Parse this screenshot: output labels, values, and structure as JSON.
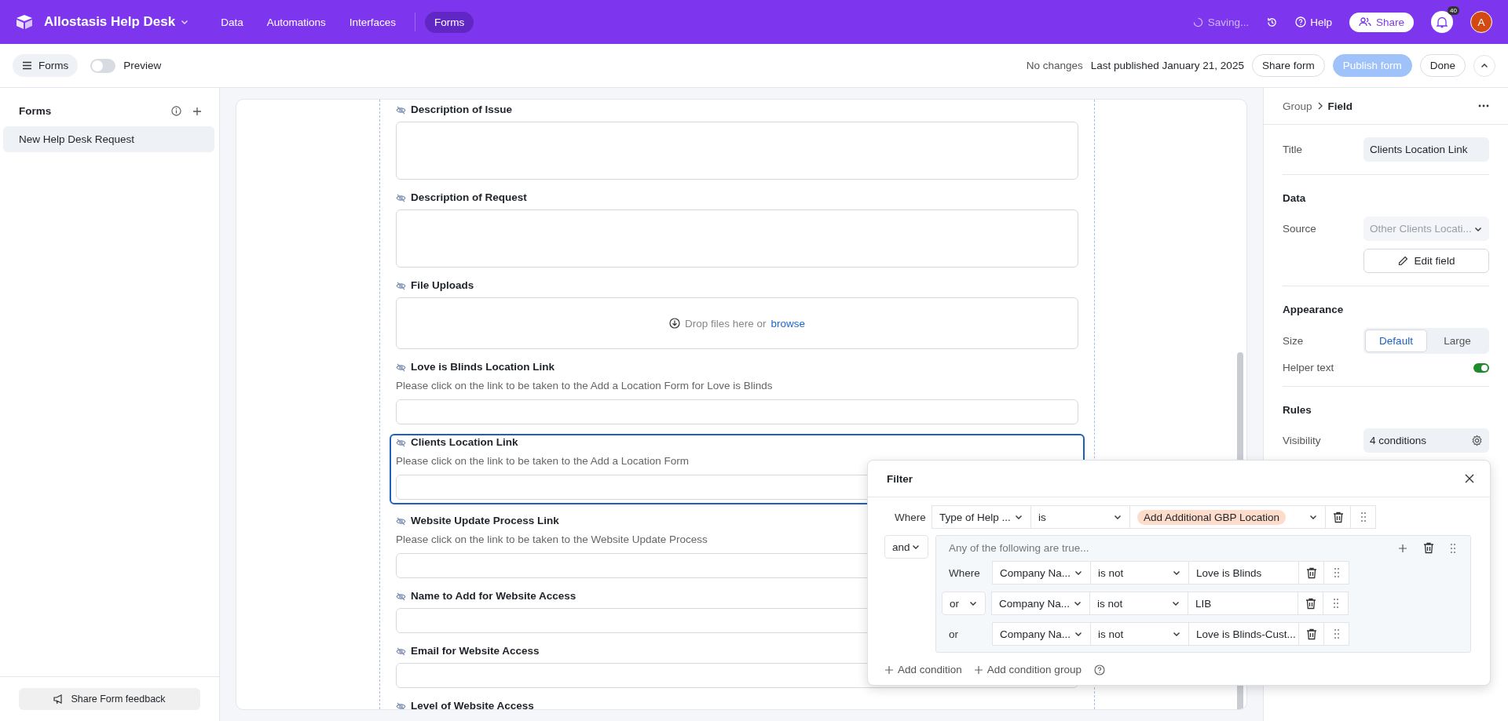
{
  "topbar": {
    "app_name": "Allostasis Help Desk",
    "nav": [
      {
        "label": "Data",
        "selected": false
      },
      {
        "label": "Automations",
        "selected": false
      },
      {
        "label": "Interfaces",
        "selected": false
      },
      {
        "label": "Forms",
        "selected": true
      }
    ],
    "status": "Saving...",
    "help": "Help",
    "share": "Share",
    "notification_count": "40",
    "avatar": "A"
  },
  "toolbar": {
    "forms_button": "Forms",
    "preview": {
      "label": "Preview",
      "on": false
    },
    "change_status": "No changes",
    "published": "Last published January 21, 2025",
    "buttons": [
      {
        "label": "Share form",
        "kind": "secondary",
        "disabled": false
      },
      {
        "label": "Publish form",
        "kind": "primary",
        "disabled": true
      },
      {
        "label": "Done",
        "kind": "secondary",
        "disabled": false
      }
    ]
  },
  "sidebar": {
    "title": "Forms",
    "items": [
      {
        "label": "New Help Desk Request",
        "selected": true
      }
    ],
    "feedback_button": "Share Form feedback"
  },
  "form": {
    "fields": [
      {
        "kind": "textarea",
        "label": "Description of Issue",
        "selected": false
      },
      {
        "kind": "textarea",
        "label": "Description of Request",
        "selected": false
      },
      {
        "kind": "upload",
        "label": "File Uploads",
        "upload_text": "Drop files here or",
        "upload_link": "browse",
        "selected": false
      },
      {
        "kind": "text",
        "label": "Love is Blinds Location Link",
        "helper": "Please click on the link to be taken to the Add a Location Form for Love is Blinds",
        "selected": false
      },
      {
        "kind": "text",
        "label": "Clients Location Link",
        "helper": "Please click on the link to be taken to the Add a Location Form",
        "selected": true
      },
      {
        "kind": "text",
        "label": "Website Update Process Link",
        "helper": "Please click on the link to be taken to the Website Update Process",
        "selected": false
      },
      {
        "kind": "text",
        "label": "Name to Add for Website Access",
        "selected": false
      },
      {
        "kind": "text",
        "label": "Email for Website Access",
        "selected": false
      },
      {
        "kind": "text",
        "label": "Level of Website Access",
        "selected": false
      }
    ]
  },
  "panel": {
    "breadcrumb": [
      "Group",
      "Field"
    ],
    "title_label": "Title",
    "title_value": "Clients Location Link",
    "data_heading": "Data",
    "source_label": "Source",
    "source_value": "Other Clients Locati...",
    "source_disabled": true,
    "edit_button": "Edit field",
    "appearance_heading": "Appearance",
    "size_label": "Size",
    "size_options": [
      {
        "label": "Default",
        "selected": true
      },
      {
        "label": "Large",
        "selected": false
      }
    ],
    "helper_label": "Helper text",
    "helper_on": true,
    "rules_heading": "Rules",
    "visibility_label": "Visibility",
    "visibility_value": "4 conditions"
  },
  "filter": {
    "title": "Filter",
    "where": "Where",
    "first": {
      "field": "Type of Help ...",
      "operator": "is",
      "value": "Add Additional GBP Location",
      "color": "#fddccb"
    },
    "conjunction": "and",
    "group": {
      "title": "Any of the following are true...",
      "conditions": [
        {
          "conjunction": "Where",
          "kind": "label",
          "field": "Company Na...",
          "operator": "is not",
          "value": "Love is Blinds"
        },
        {
          "conjunction": "or",
          "kind": "dropdown",
          "field": "Company Na...",
          "operator": "is not",
          "value": "LIB"
        },
        {
          "conjunction": "or",
          "kind": "label",
          "field": "Company Na...",
          "operator": "is not",
          "value": "Love is Blinds-Cust..."
        }
      ]
    },
    "add_condition": "Add condition",
    "add_group": "Add condition group"
  }
}
